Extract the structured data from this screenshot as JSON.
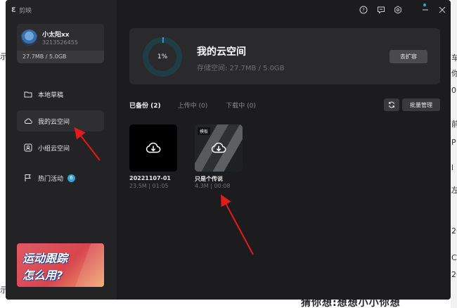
{
  "background": {
    "left_edge_chars": [
      "示",
      "示"
    ],
    "right_edge_chars": [
      "车",
      "你",
      "0",
      "前",
      "P",
      "l",
      "左",
      "20",
      "C",
      "20"
    ],
    "bottom_text": "猜你想:想想小小你想"
  },
  "app": {
    "logo_text": "剪映",
    "user": {
      "name": "小太阳xx",
      "id": "3213526455",
      "storage": "27.7MB / 5.0GB"
    },
    "nav": [
      {
        "label": "本地草稿",
        "icon": "folder-icon"
      },
      {
        "label": "我的云空间",
        "icon": "cloud-icon"
      },
      {
        "label": "小组云空间",
        "icon": "group-cloud-icon"
      },
      {
        "label": "热门活动",
        "icon": "flag-icon",
        "badge": "6"
      }
    ],
    "banner": {
      "line1": "运动跟踪",
      "line2": "怎么用?"
    },
    "window_controls": [
      "help-icon",
      "feedback-icon",
      "settings-icon",
      "minimize-icon",
      "close-icon"
    ],
    "space": {
      "percent": "1%",
      "percent_value": 0.01,
      "title": "我的云空间",
      "subtitle": "存储空间: 27.7MB / 5.0GB",
      "expand_label": "去扩容"
    },
    "tabs": [
      {
        "label": "已备份 (2)",
        "active": true
      },
      {
        "label": "上传中 (0)",
        "active": false
      },
      {
        "label": "下载中 (0)",
        "active": false
      }
    ],
    "batch_label": "批量管理",
    "files": [
      {
        "name": "20221107-01",
        "meta": "23.5M | 01:05"
      },
      {
        "name": "只是个传说",
        "meta": "4.3M | 00:08",
        "tag": "模板"
      }
    ],
    "colors": {
      "accent": "#2aa7d8",
      "arrow": "#e31b1b",
      "panel": "#1c1c1e",
      "sidebar": "#232325"
    }
  }
}
